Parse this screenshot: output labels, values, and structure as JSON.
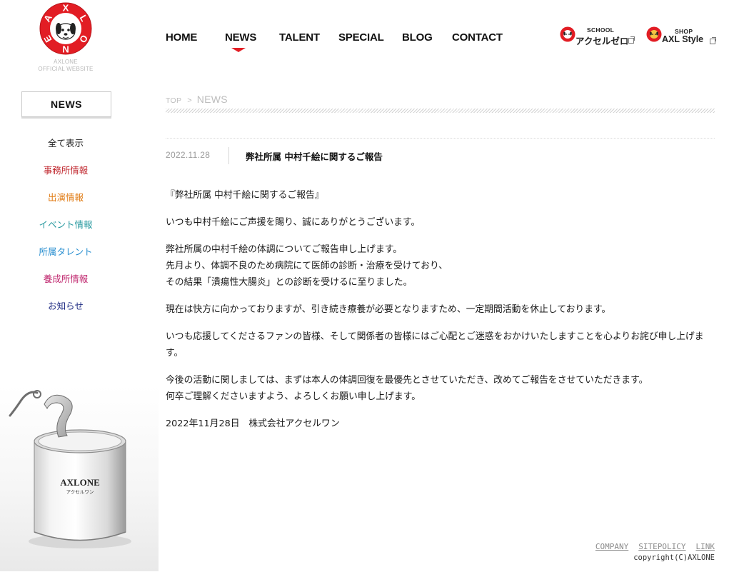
{
  "site": {
    "logo_caption_line1": "AXLONE",
    "logo_caption_line2": "OFFICIAL WEBSITE",
    "logo_letters": [
      "A",
      "X",
      "L",
      "O",
      "N",
      "E"
    ]
  },
  "global_nav": {
    "items": [
      {
        "label": "HOME"
      },
      {
        "label": "NEWS",
        "active": true
      },
      {
        "label": "TALENT"
      },
      {
        "label": "SPECIAL"
      },
      {
        "label": "BLOG"
      },
      {
        "label": "CONTACT"
      }
    ],
    "active_marker_color": "#e21d24"
  },
  "external_links": {
    "school": {
      "small": "SCHOOL",
      "big": "アクセルゼロ",
      "icon": "external-window-icon"
    },
    "shop": {
      "small": "SHOP",
      "big": "AXL Style",
      "icon": "external-window-icon"
    }
  },
  "side_nav": {
    "heading": "NEWS",
    "items": [
      {
        "label": "全て表示",
        "color": "#222222"
      },
      {
        "label": "事務所情報",
        "color": "#c0282f"
      },
      {
        "label": "出演情報",
        "color": "#e07a12"
      },
      {
        "label": "イベント情報",
        "color": "#2a9aa0"
      },
      {
        "label": "所属タレント",
        "color": "#2a8fd0"
      },
      {
        "label": "養成所情報",
        "color": "#c0286f"
      },
      {
        "label": "お知らせ",
        "color": "#1d2a82"
      }
    ]
  },
  "can_image": {
    "brand": "AXLONE",
    "sub": "アクセルワン"
  },
  "breadcrumb": {
    "top": "TOP",
    "separator": ">",
    "current": "NEWS"
  },
  "post": {
    "date": "2022.11.28",
    "title": "弊社所属 中村千絵に関するご報告",
    "paragraphs": [
      [
        "『弊社所属 中村千絵に関するご報告』"
      ],
      [
        "いつも中村千絵にご声援を賜り、誠にありがとうございます。"
      ],
      [
        "弊社所属の中村千絵の体調についてご報告申し上げます。",
        "先月より、体調不良のため病院にて医師の診断・治療を受けており、",
        "その結果「潰瘍性大腸炎」との診断を受けるに至りました。"
      ],
      [
        "現在は快方に向かっておりますが、引き続き療養が必要となりますため、一定期間活動を休止しております。"
      ],
      [
        "いつも応援してくださるファンの皆様、そして関係者の皆様にはご心配とご迷惑をおかけいたしますことを心よりお詫び申し上げます。"
      ],
      [
        "今後の活動に関しましては、まずは本人の体調回復を最優先とさせていただき、改めてご報告をさせていただきます。",
        "何卒ご理解くださいますよう、よろしくお願い申し上げます。"
      ],
      [
        "2022年11月28日　株式会社アクセルワン"
      ]
    ]
  },
  "footer": {
    "links": [
      "COMPANY",
      "SITEPOLICY",
      "LINK"
    ],
    "copyright": "copyright(C)AXLONE"
  }
}
